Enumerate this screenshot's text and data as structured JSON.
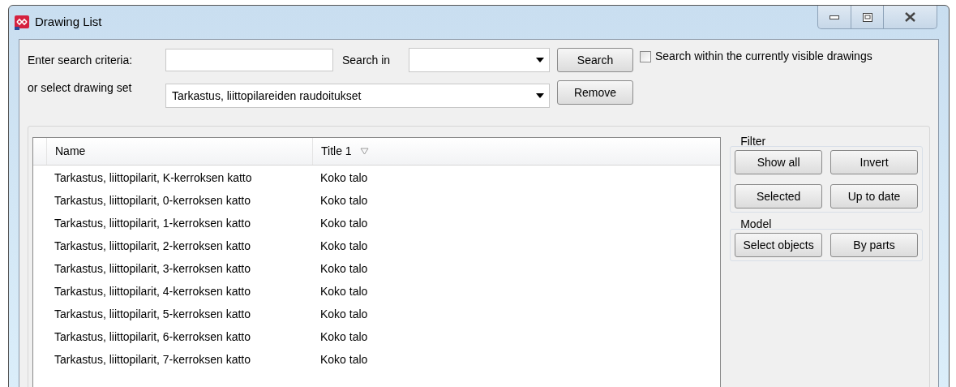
{
  "window": {
    "title": "Drawing List"
  },
  "search": {
    "label": "Enter search criteria:",
    "search_in_label": "Search in",
    "button": "Search",
    "checkbox": {
      "label": "Search within the currently visible drawings",
      "checked": false
    }
  },
  "drawing_set": {
    "label": "or select drawing set",
    "value": "Tarkastus, liittopilareiden raudoitukset",
    "button": "Remove"
  },
  "table": {
    "columns": [
      {
        "label": "Name",
        "sorted": false
      },
      {
        "label": "Title 1",
        "sorted": true
      }
    ],
    "rows": [
      [
        "Tarkastus, liittopilarit, K-kerroksen katto",
        "Koko talo"
      ],
      [
        "Tarkastus, liittopilarit, 0-kerroksen katto",
        "Koko talo"
      ],
      [
        "Tarkastus, liittopilarit, 1-kerroksen katto",
        "Koko talo"
      ],
      [
        "Tarkastus, liittopilarit, 2-kerroksen katto",
        "Koko talo"
      ],
      [
        "Tarkastus, liittopilarit, 3-kerroksen katto",
        "Koko talo"
      ],
      [
        "Tarkastus, liittopilarit, 4-kerroksen katto",
        "Koko talo"
      ],
      [
        "Tarkastus, liittopilarit, 5-kerroksen katto",
        "Koko talo"
      ],
      [
        "Tarkastus, liittopilarit, 6-kerroksen katto",
        "Koko talo"
      ],
      [
        "Tarkastus, liittopilarit, 7-kerroksen katto",
        "Koko talo"
      ]
    ]
  },
  "filter": {
    "title": "Filter",
    "buttons": [
      "Show all",
      "Invert",
      "Selected",
      "Up to date"
    ]
  },
  "model": {
    "title": "Model",
    "buttons": [
      "Select objects",
      "By parts"
    ]
  }
}
